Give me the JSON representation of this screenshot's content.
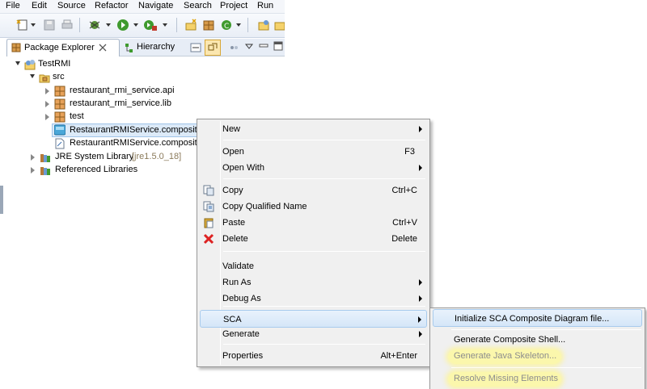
{
  "menubar": [
    "File",
    "Edit",
    "Source",
    "Refactor",
    "Navigate",
    "Search",
    "Project",
    "Run"
  ],
  "view_tabs": {
    "package_explorer": "Package Explorer",
    "hierarchy": "Hierarchy"
  },
  "tree": {
    "project": "TestRMI",
    "src": "src",
    "packages": [
      "restaurant_rmi_service.api",
      "restaurant_rmi_service.lib",
      "test"
    ],
    "files": [
      "RestaurantRMIService.composite",
      "RestaurantRMIService.composite"
    ],
    "jre_label": "JRE System Library",
    "jre_version": "[jre1.5.0_18]",
    "ref_libs": "Referenced Libraries"
  },
  "context_menu": {
    "new": "New",
    "open": "Open",
    "open_key": "F3",
    "open_with": "Open With",
    "copy": "Copy",
    "copy_key": "Ctrl+C",
    "copy_qualified": "Copy Qualified Name",
    "paste": "Paste",
    "paste_key": "Ctrl+V",
    "delete": "Delete",
    "delete_key": "Delete",
    "validate": "Validate",
    "run_as": "Run As",
    "debug_as": "Debug As",
    "sca": "SCA",
    "generate": "Generate",
    "properties": "Properties",
    "properties_key": "Alt+Enter"
  },
  "sca_submenu": {
    "init_diagram": "Initialize SCA Composite Diagram file...",
    "gen_shell": "Generate Composite Shell...",
    "gen_java": "Generate Java Skeleton...",
    "resolve": "Resolve Missing Elements"
  },
  "colors": {
    "selection": "#dceaf8",
    "menu_bg": "#f0f0f0",
    "highlight_glow": "#fffa96",
    "disabled_text": "#8d8d8d"
  }
}
